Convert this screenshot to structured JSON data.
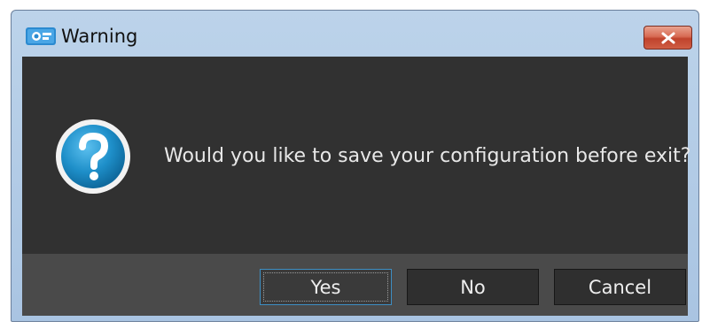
{
  "window": {
    "title": "Warning",
    "app_icon": "app-logo-icon",
    "close_icon": "close-icon"
  },
  "dialog": {
    "icon": "question-icon",
    "message": "Would you like to save your configuration before exit?"
  },
  "buttons": {
    "yes_label": "Yes",
    "no_label": "No",
    "cancel_label": "Cancel",
    "default": "Yes"
  },
  "colors": {
    "content_bg": "#313131",
    "footer_bg": "#4a4a4a",
    "button_bg": "#2f2f2f",
    "focus_border": "#3d8fc4",
    "text": "#e8e8e8",
    "icon_accent": "#1e8fc9"
  }
}
